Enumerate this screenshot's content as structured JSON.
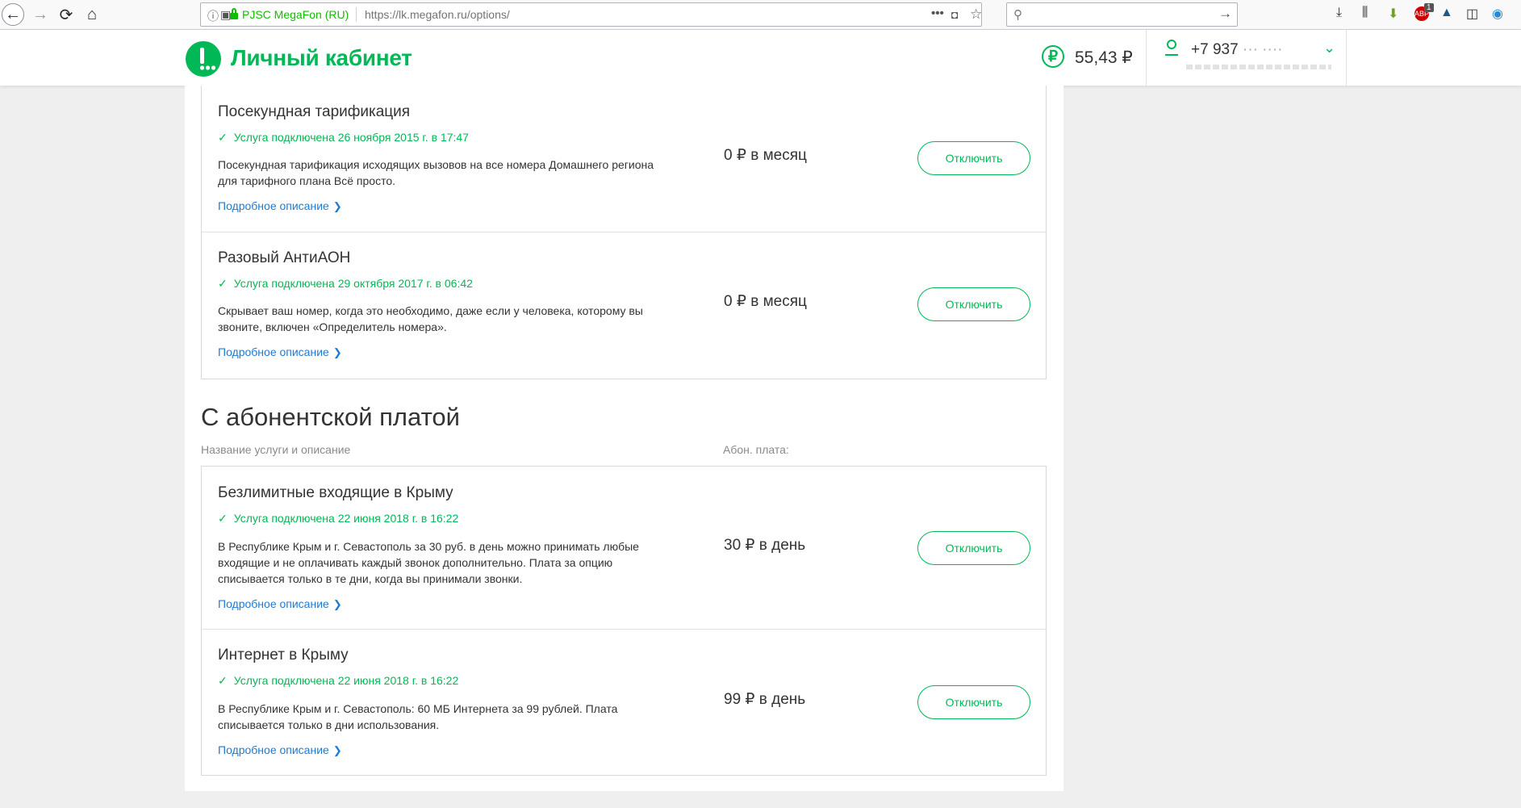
{
  "browser": {
    "site_identity": "PJSC MegaFon (RU)",
    "url": "https://lk.megafon.ru/options/",
    "url_more_label": "•••",
    "search_placeholder": "",
    "badge_count": "1"
  },
  "header": {
    "title": "Личный кабинет",
    "currency_symbol": "₽",
    "balance": "55,43 ₽",
    "phone": "+7 937 ",
    "phone_masked": "··· ····",
    "brand_color": "#00b956"
  },
  "section": {
    "heading": "С абонентской платой",
    "col_name": "Название услуги и описание",
    "col_fee": "Абон. плата:"
  },
  "free_services": [
    {
      "title": "Посекундная тарификация",
      "status": "Услуга подключена 26 ноября 2015 г. в 17:47",
      "description": "Посекундная тарификация исходящих вызовов на все номера Домашнего региона для тарифного плана Всё просто.",
      "link": "Подробное описание",
      "price": "0 ₽ в месяц",
      "button": "Отключить"
    },
    {
      "title": "Разовый АнтиАОН",
      "status": "Услуга подключена 29 октября 2017 г. в 06:42",
      "description": "Скрывает ваш номер, когда это необходимо, даже если у человека, которому вы звоните, включен «Определитель номера».",
      "link": "Подробное описание",
      "price": "0 ₽ в месяц",
      "button": "Отключить"
    }
  ],
  "paid_services": [
    {
      "title": "Безлимитные входящие в Крыму",
      "status": "Услуга подключена 22 июня 2018 г. в 16:22",
      "description": "В Республике Крым и г. Севастополь за 30 руб. в день можно принимать любые входящие и не оплачивать каждый звонок дополнительно. Плата за опцию списывается только в те дни, когда вы принимали звонки.",
      "link": "Подробное описание",
      "price": "30 ₽ в день",
      "button": "Отключить"
    },
    {
      "title": "Интернет в Крыму",
      "status": "Услуга подключена 22 июня 2018 г. в 16:22",
      "description": "В Республике Крым и г. Севастополь: 60 МБ Интернета за 99 рублей. Плата списывается только в дни использования.",
      "link": "Подробное описание",
      "price": "99 ₽ в день",
      "button": "Отключить"
    }
  ]
}
